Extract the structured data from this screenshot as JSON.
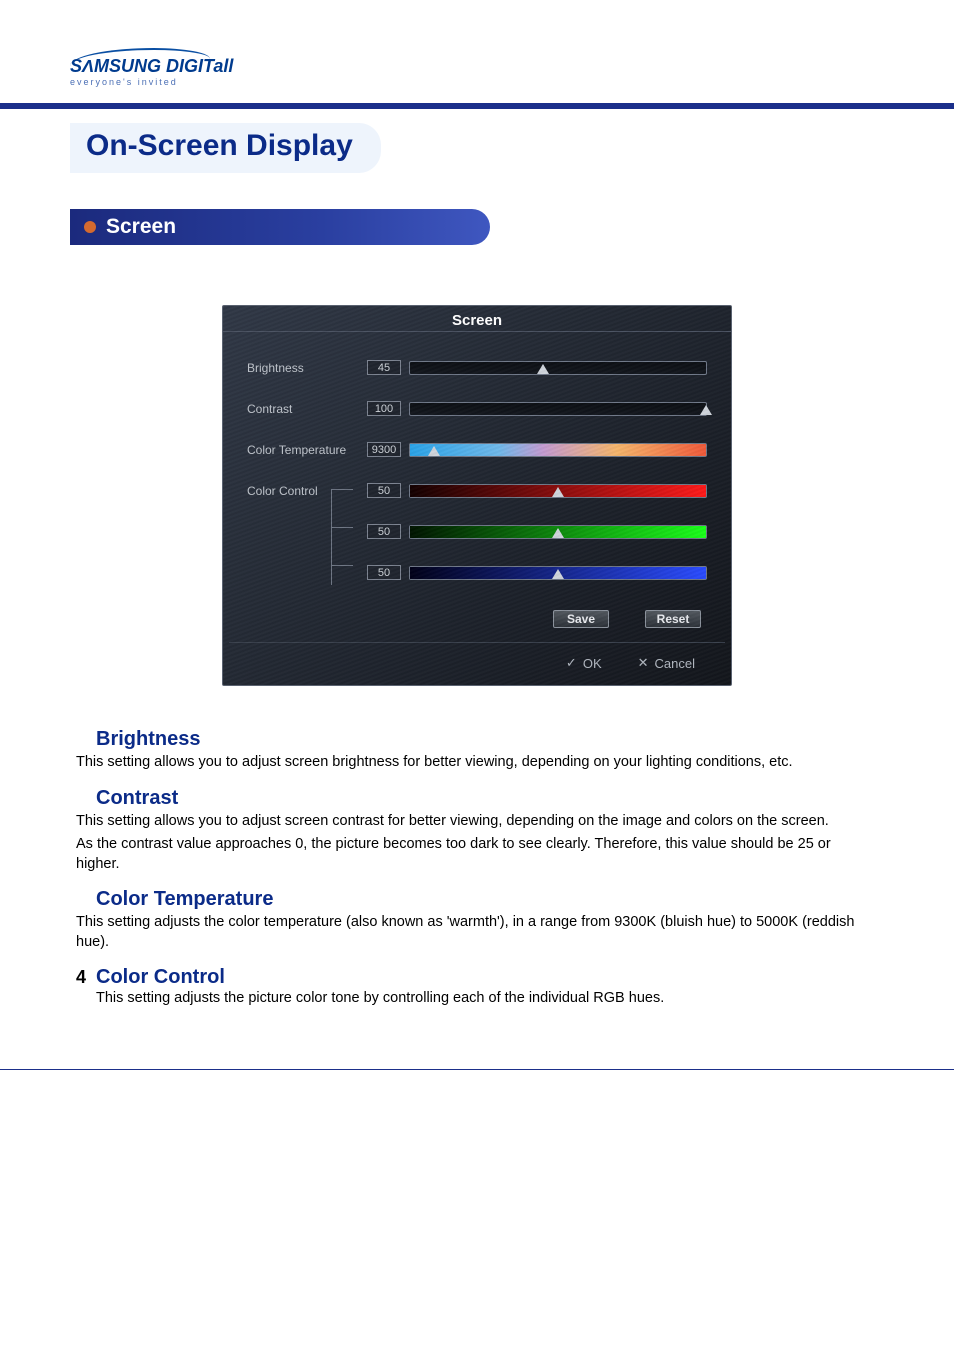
{
  "logo": {
    "brand": "SΛMSUNG DIGITall",
    "tagline": "everyone's invited"
  },
  "page_title": "On-Screen Display",
  "section_heading": "Screen",
  "osd": {
    "title": "Screen",
    "rows": {
      "brightness": {
        "label": "Brightness",
        "value": "45",
        "percent": 45
      },
      "contrast": {
        "label": "Contrast",
        "value": "100",
        "percent": 100
      },
      "color_temp": {
        "label": "Color Temperature",
        "value": "9300",
        "percent": 8
      },
      "color_control": {
        "label": "Color Control",
        "r": {
          "value": "50",
          "percent": 50
        },
        "g": {
          "value": "50",
          "percent": 50
        },
        "b": {
          "value": "50",
          "percent": 50
        }
      }
    },
    "buttons": {
      "save": "Save",
      "reset": "Reset",
      "ok": "OK",
      "cancel": "Cancel"
    }
  },
  "descriptions": {
    "brightness": {
      "title": "Brightness",
      "text": "This setting allows you to adjust screen brightness for better viewing, depending on your lighting conditions, etc."
    },
    "contrast": {
      "title": "Contrast",
      "p1": "This setting allows you to adjust screen contrast for better viewing, depending on the image and colors on the screen.",
      "p2": "As the contrast value approaches 0, the picture becomes too dark to see clearly. Therefore, this value should be 25 or higher."
    },
    "color_temp": {
      "title": "Color Temperature",
      "text": "This setting adjusts the color temperature (also known as 'warmth'), in a range from 9300K (bluish hue) to 5000K (reddish hue)."
    },
    "color_control": {
      "num": "4",
      "title": "Color Control",
      "text": "This setting adjusts the picture color tone by controlling each of the individual RGB hues."
    }
  }
}
